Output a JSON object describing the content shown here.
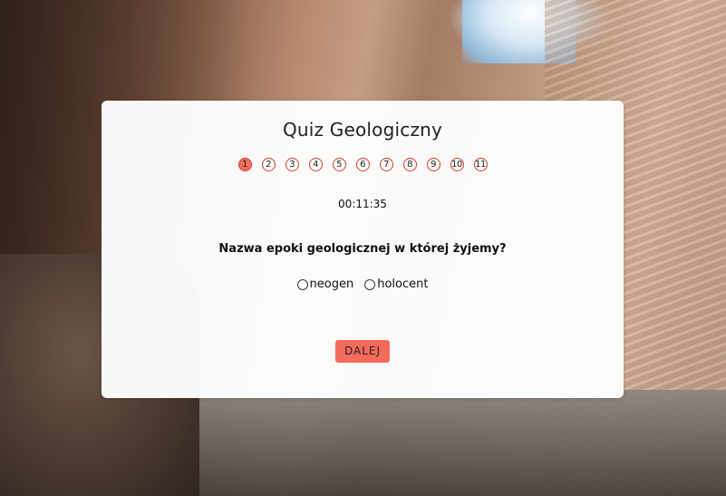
{
  "quiz": {
    "title": "Quiz Geologiczny",
    "steps": [
      "1",
      "2",
      "3",
      "4",
      "5",
      "6",
      "7",
      "8",
      "9",
      "10",
      "11"
    ],
    "active_step": "1",
    "timer": "00:11:35",
    "question": "Nazwa epoki geologicznej w której żyjemy?",
    "answers": [
      {
        "label": "neogen"
      },
      {
        "label": "holocent"
      }
    ],
    "next_label": "DALEJ"
  },
  "colors": {
    "accent": "#f56b5b",
    "step_border": "#d43c2c",
    "card_bg": "#ffffff"
  }
}
